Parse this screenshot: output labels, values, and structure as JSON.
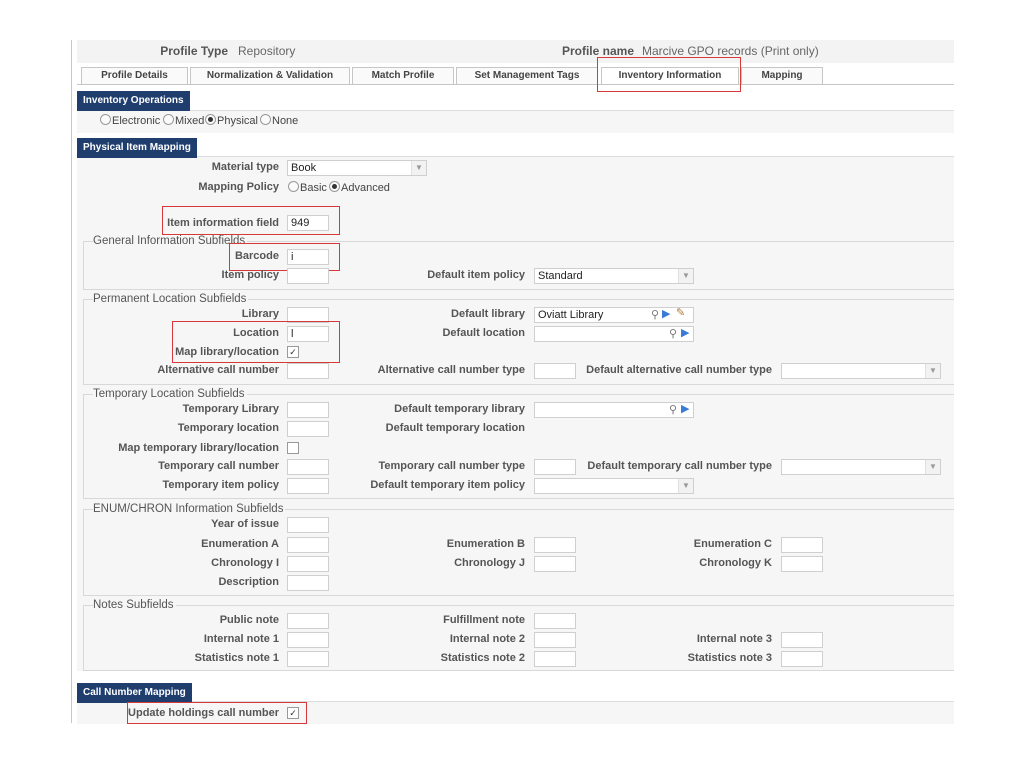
{
  "header": {
    "profile_type_label": "Profile Type",
    "profile_type_value": "Repository",
    "profile_name_label": "Profile name",
    "profile_name_value": "Marcive GPO records (Print only)"
  },
  "tabs": [
    {
      "label": "Profile Details"
    },
    {
      "label": "Normalization & Validation"
    },
    {
      "label": "Match Profile"
    },
    {
      "label": "Set Management Tags"
    },
    {
      "label": "Inventory Information"
    },
    {
      "label": "Mapping"
    }
  ],
  "inventory_operations": {
    "title": "Inventory Operations",
    "options": [
      "Electronic",
      "Mixed",
      "Physical",
      "None"
    ],
    "selected": "Physical"
  },
  "physical_item_mapping": {
    "title": "Physical Item Mapping",
    "material_type_label": "Material type",
    "material_type_value": "Book",
    "mapping_policy_label": "Mapping Policy",
    "mapping_policy_options": [
      "Basic",
      "Advanced"
    ],
    "mapping_policy_selected": "Advanced",
    "item_info_field_label": "Item information field",
    "item_info_field_value": "949"
  },
  "general_info": {
    "legend": "General Information Subfields",
    "barcode_label": "Barcode",
    "barcode_value": "i",
    "item_policy_label": "Item policy",
    "default_item_policy_label": "Default item policy",
    "default_item_policy_value": "Standard"
  },
  "permanent_location": {
    "legend": "Permanent Location Subfields",
    "library_label": "Library",
    "default_library_label": "Default library",
    "default_library_value": "Oviatt Library",
    "location_label": "Location",
    "location_value": "l",
    "default_location_label": "Default location",
    "map_library_location_label": "Map library/location",
    "map_library_location_checked": true,
    "alt_call_number_label": "Alternative call number",
    "alt_call_number_type_label": "Alternative call number type",
    "default_alt_call_number_type_label": "Default alternative call number type"
  },
  "temporary_location": {
    "legend": "Temporary Location Subfields",
    "temp_library_label": "Temporary Library",
    "default_temp_library_label": "Default temporary library",
    "temp_location_label": "Temporary location",
    "default_temp_location_label": "Default temporary location",
    "map_temp_label": "Map temporary library/location",
    "map_temp_checked": false,
    "temp_call_number_label": "Temporary call number",
    "temp_call_number_type_label": "Temporary call number type",
    "default_temp_call_number_type_label": "Default temporary call number type",
    "temp_item_policy_label": "Temporary item policy",
    "default_temp_item_policy_label": "Default temporary item policy"
  },
  "enum_chron": {
    "legend": "ENUM/CHRON Information Subfields",
    "year_of_issue_label": "Year of issue",
    "enum_a_label": "Enumeration A",
    "enum_b_label": "Enumeration B",
    "enum_c_label": "Enumeration C",
    "chron_i_label": "Chronology I",
    "chron_j_label": "Chronology J",
    "chron_k_label": "Chronology K",
    "description_label": "Description"
  },
  "notes": {
    "legend": "Notes Subfields",
    "public_note_label": "Public note",
    "fulfillment_note_label": "Fulfillment note",
    "internal_note_1_label": "Internal note 1",
    "internal_note_2_label": "Internal note 2",
    "internal_note_3_label": "Internal note 3",
    "statistics_note_1_label": "Statistics note 1",
    "statistics_note_2_label": "Statistics note 2",
    "statistics_note_3_label": "Statistics note 3"
  },
  "call_number_mapping": {
    "title": "Call Number Mapping",
    "update_holdings_label": "Update holdings call number",
    "update_holdings_checked": true
  },
  "colors": {
    "section_header": "#1f3e6e",
    "highlight_box": "#d93838"
  },
  "icons": {
    "search": "search-icon",
    "arrow": "arrow-right-icon",
    "clear": "broom-icon",
    "dropdown": "chevron-down-icon"
  }
}
